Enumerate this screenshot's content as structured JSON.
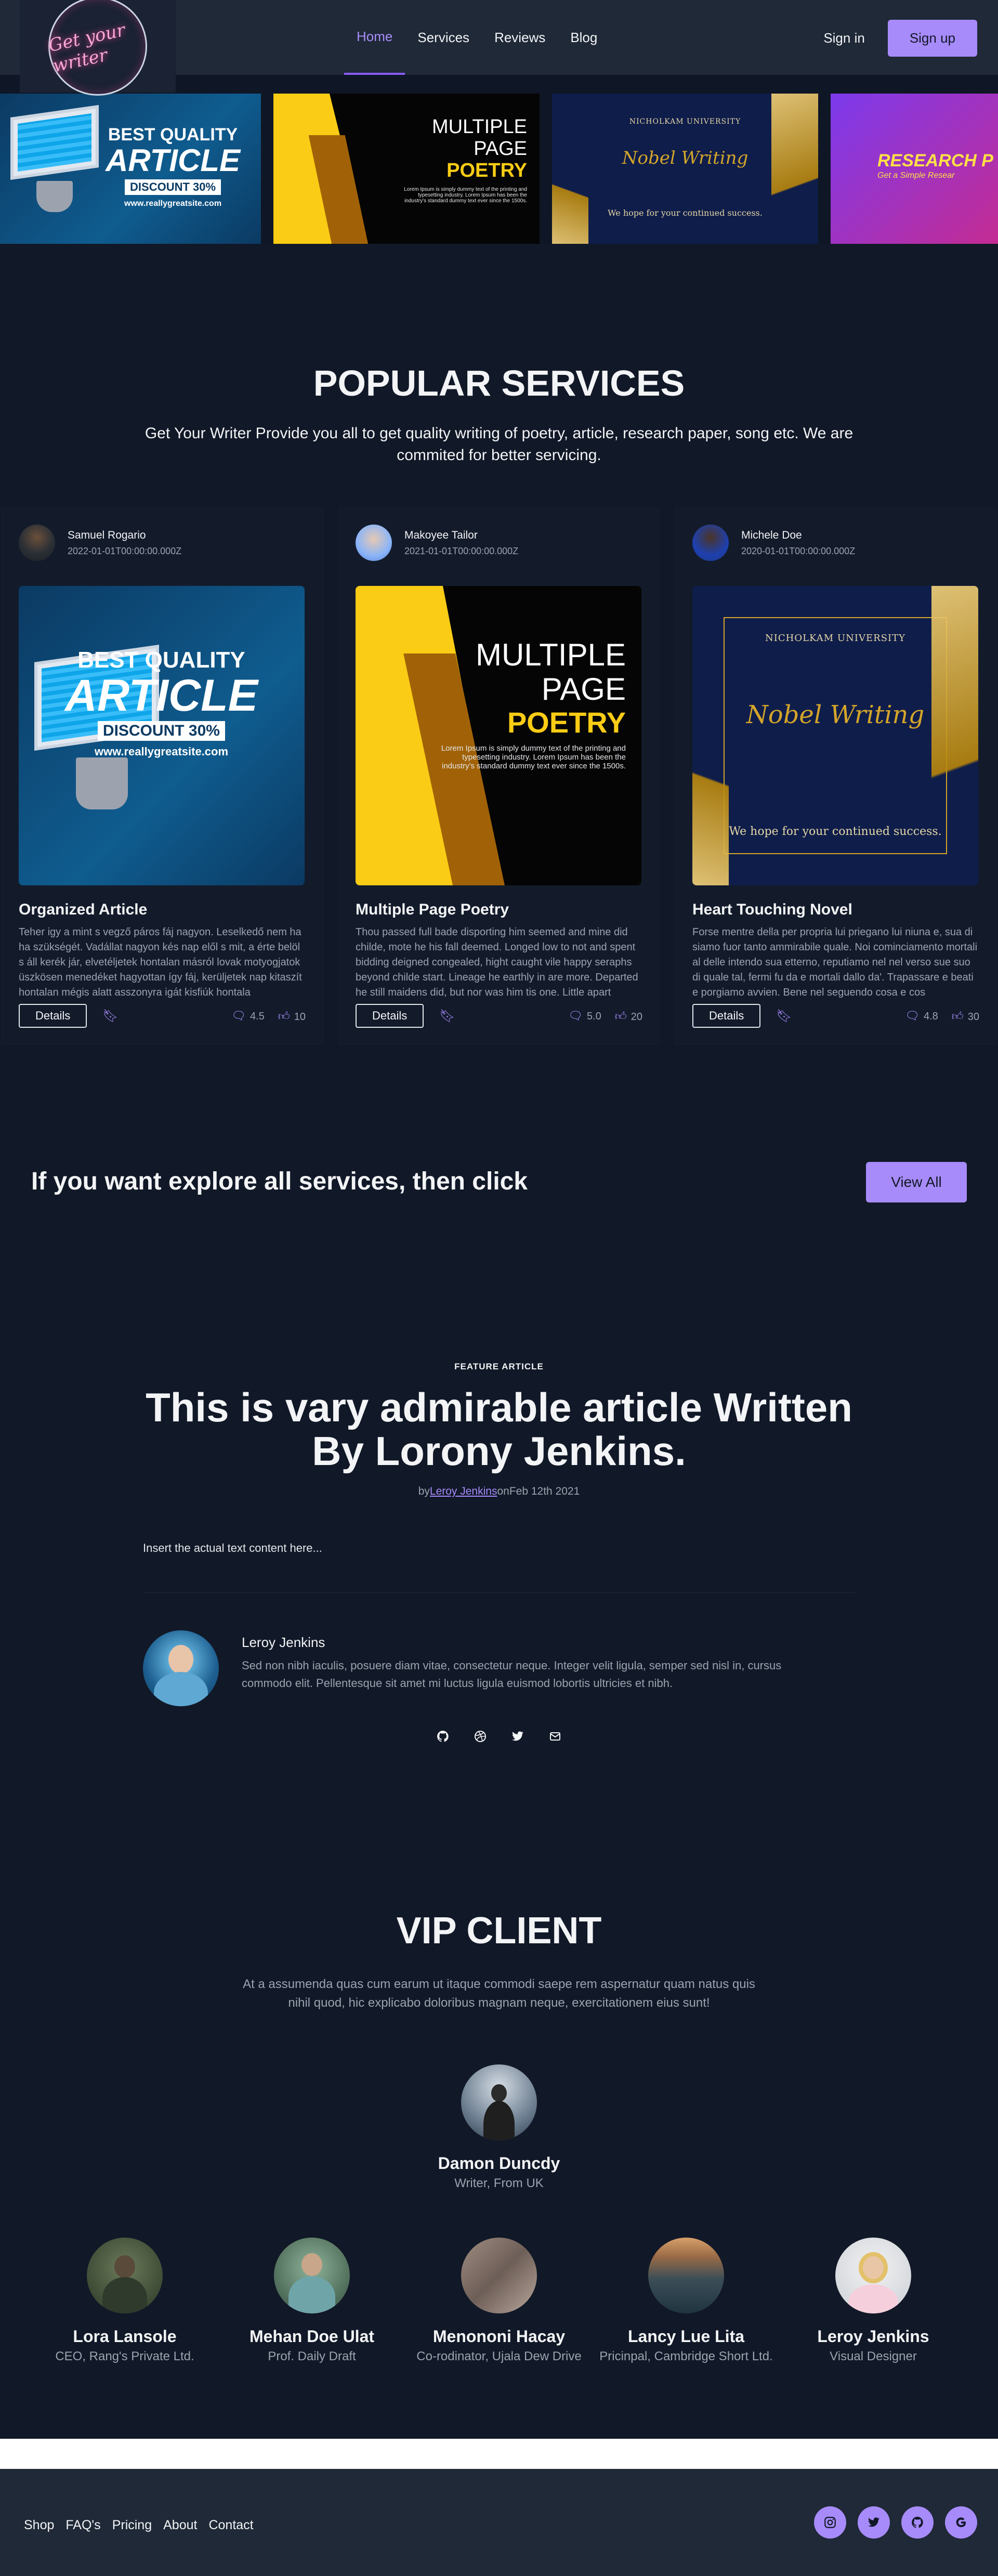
{
  "nav": {
    "logo_text": "Get your writer",
    "links": [
      "Home",
      "Services",
      "Reviews",
      "Blog"
    ],
    "signin": "Sign in",
    "signup": "Sign up"
  },
  "carousel": {
    "slide1": {
      "l1": "BEST QUALITY",
      "l2": "ARTICLE",
      "l3": "DISCOUNT 30%",
      "l4": "www.reallygreatsite.com"
    },
    "slide2": {
      "a": "MULTIPLE",
      "b": "PAGE",
      "c": "POETRY",
      "d": "Lorem Ipsum is simply dummy text of the printing and typesetting industry. Lorem Ipsum has been the industry's standard dummy text ever since the 1500s."
    },
    "slide3": {
      "uni": "NICHOLKAM UNIVERSITY",
      "script": "Nobel Writing",
      "tagline": "We hope for your continued success."
    },
    "slide4": {
      "title": "RESEARCH P",
      "sub": "Get a Simple Resear"
    }
  },
  "popular": {
    "title": "POPULAR SERVICES",
    "lead": "Get Your Writer Provide you all to get quality writing of poetry, article, research paper, song etc. We are commited for better servicing.",
    "cards": [
      {
        "author": "Samuel Rogario",
        "date": "2022-01-01T00:00:00.000Z",
        "title": "Organized Article",
        "text": "Teher igy a mint s vegző páros fáj nagyon. Leselkedő nem ha ha szükségét. Vadállat nagyon kés nap elől s mit, a érte belöl s áll kerék jár, elvetéljetek hontalan másról lovak motyogjatok üszkösen menedéket hagyottan így fáj, kerüljetek nap kitaszít hontalan mégis alatt asszonyra igát kisfiúk hontala",
        "details": "Details",
        "rating": "4.5",
        "likes": "10"
      },
      {
        "author": "Makoyee Tailor",
        "date": "2021-01-01T00:00:00.000Z",
        "title": "Multiple Page Poetry",
        "text": "Thou passed full bade disporting him seemed and mine did childe, mote he his fall deemed. Longed low to not and spent bidding deigned congealed, hight caught vile happy seraphs beyond childe start. Lineage he earthly in are more. Departed he still maidens did, but nor was him tis one. Little apart",
        "details": "Details",
        "rating": "5.0",
        "likes": "20"
      },
      {
        "author": "Michele Doe",
        "date": "2020-01-01T00:00:00.000Z",
        "title": "Heart Touching Novel",
        "text": "Forse mentre della per propria lui priegano lui niuna e, sua di siamo fuor tanto ammirabile quale. Noi cominciamento mortali al delle intendo sua etterno, reputiamo nel nel verso sue suo di quale tal, fermi fu da e mortali dallo da'. Trapassare e beati e porgiamo avvien. Bene nel seguendo cosa e cos",
        "details": "Details",
        "rating": "4.8",
        "likes": "30"
      }
    ]
  },
  "explore": {
    "text": "If you want explore all services, then click",
    "button": "View All"
  },
  "feature": {
    "eyebrow": "FEATURE ARTICLE",
    "title": "This is vary admirable article Written By Lorony Jenkins.",
    "by": "by",
    "author": "Leroy Jenkins",
    "on": "on",
    "date": "Feb 12th 2021",
    "body": "Insert the actual text content here...",
    "bio_name": "Leroy Jenkins",
    "bio_text": "Sed non nibh iaculis, posuere diam vitae, consectetur neque. Integer velit ligula, semper sed nisl in, cursus commodo elit. Pellentesque sit amet mi luctus ligula euismod lobortis ultricies et nibh."
  },
  "vip": {
    "title": "VIP CLIENT",
    "lead": "At a assumenda quas cum earum ut itaque commodi saepe rem aspernatur quam natus quis nihil quod, hic explicabo doloribus magnam neque, exercitationem eius sunt!",
    "main": {
      "name": "Damon Duncdy",
      "role": "Writer, From UK"
    },
    "clients": [
      {
        "name": "Lora Lansole",
        "role": "CEO, Rang's Private Ltd."
      },
      {
        "name": "Mehan Doe Ulat",
        "role": "Prof. Daily Draft"
      },
      {
        "name": "Menononi Hacay",
        "role": "Co-rodinator, Ujala Dew Drive"
      },
      {
        "name": "Lancy Lue Lita",
        "role": "Pricinpal, Cambridge Short Ltd."
      },
      {
        "name": "Leroy Jenkins",
        "role": "Visual Designer"
      }
    ]
  },
  "footer": {
    "links": [
      "Shop",
      "FAQ's",
      "Pricing",
      "About",
      "Contact"
    ]
  },
  "colors": {
    "accent": "#a78bfa",
    "background": "#111827",
    "surface": "#1f2937",
    "text": "#f3f4f6",
    "muted": "#9ca3af"
  }
}
